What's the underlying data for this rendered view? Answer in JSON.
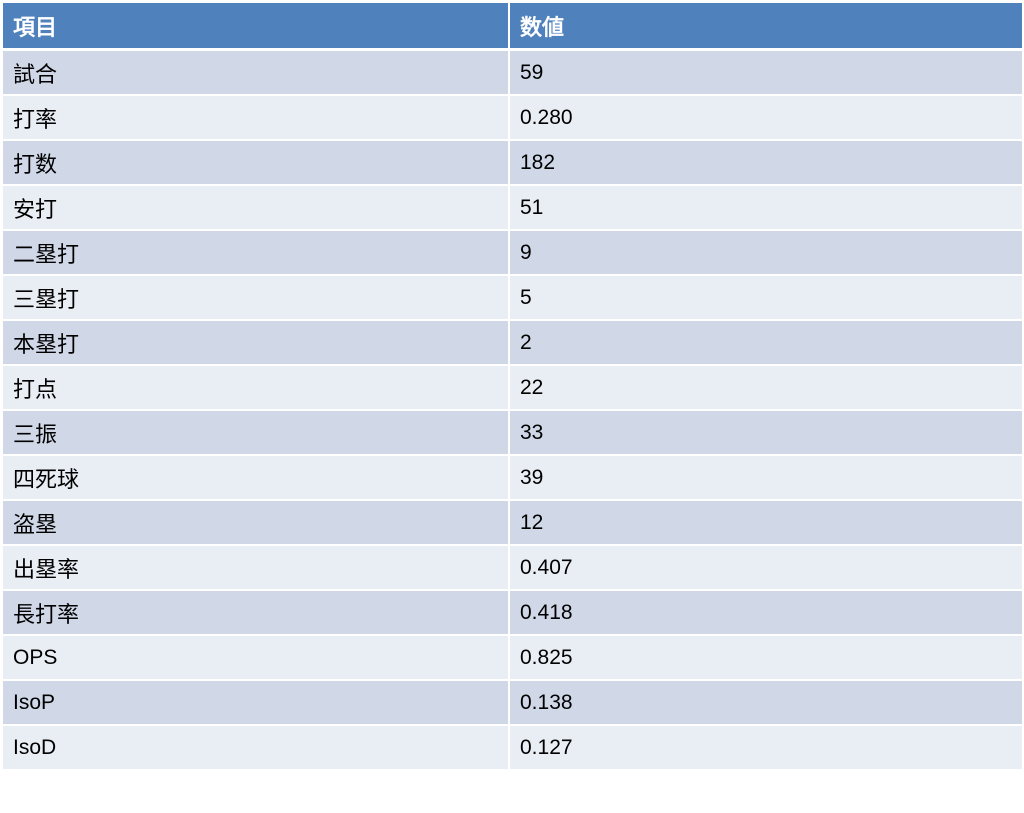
{
  "table": {
    "headers": {
      "item": "項目",
      "value": "数値"
    },
    "rows": [
      {
        "item": "試合",
        "value": "59"
      },
      {
        "item": "打率",
        "value": "0.280"
      },
      {
        "item": "打数",
        "value": "182"
      },
      {
        "item": "安打",
        "value": "51"
      },
      {
        "item": "二塁打",
        "value": "9"
      },
      {
        "item": "三塁打",
        "value": "5"
      },
      {
        "item": "本塁打",
        "value": "2"
      },
      {
        "item": "打点",
        "value": "22"
      },
      {
        "item": "三振",
        "value": "33"
      },
      {
        "item": "四死球",
        "value": "39"
      },
      {
        "item": "盗塁",
        "value": "12"
      },
      {
        "item": "出塁率",
        "value": "0.407"
      },
      {
        "item": "長打率",
        "value": "0.418"
      },
      {
        "item": "OPS",
        "value": "0.825"
      },
      {
        "item": "IsoP",
        "value": "0.138"
      },
      {
        "item": "IsoD",
        "value": "0.127"
      }
    ]
  },
  "colors": {
    "header_bg": "#4f81bd",
    "row_dark": "#d0d8e8",
    "row_light": "#e9edf4"
  }
}
